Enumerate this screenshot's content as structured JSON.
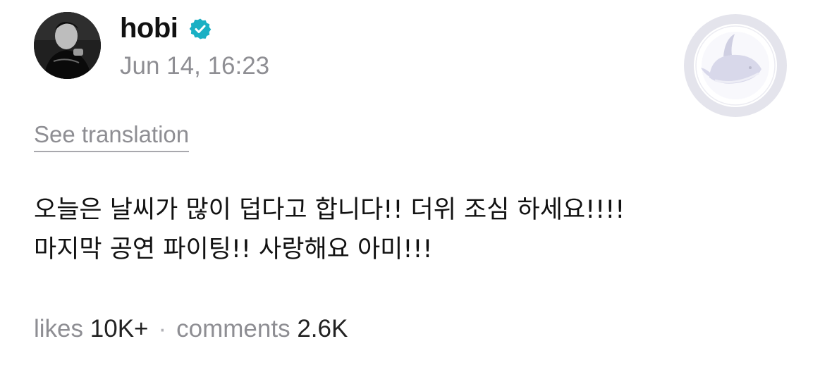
{
  "post": {
    "author": "hobi",
    "verified_icon": "verified-badge-icon",
    "timestamp": "Jun 14, 16:23",
    "see_translation": "See translation",
    "body_lines": [
      "오늘은 날씨가 많이 덥다고 합니다!! 더위 조심 하세요!!!!",
      "마지막 공연 파이팅!! 사랑해요 아미!!!"
    ],
    "stats": {
      "likes_label": "likes",
      "likes_value": "10K+",
      "separator": "·",
      "comments_label": "comments",
      "comments_value": "2.6K"
    }
  },
  "colors": {
    "verified": "#1ab0c4",
    "muted_text": "#8e8e93",
    "primary_text": "#111111"
  }
}
